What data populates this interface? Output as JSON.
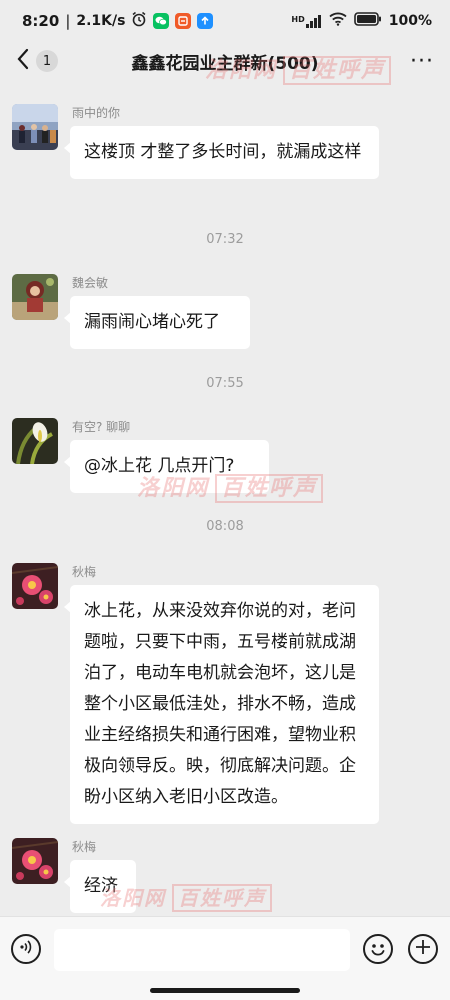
{
  "status_bar": {
    "time": "8:20",
    "network_speed": "2.1K/s",
    "signal_type": "HD",
    "battery": "100%",
    "icons": [
      "alarm-icon",
      "wechat-icon",
      "app-icon",
      "upload-icon",
      "signal-icon",
      "wifi-icon",
      "battery-icon"
    ]
  },
  "nav": {
    "unread_count": "1",
    "title": "鑫鑫花园业主群新(500)",
    "more_label": "···"
  },
  "messages": [
    {
      "sender": "雨中的你",
      "text": "这楼顶 才整了多长时间，就漏成这样"
    },
    {
      "time": "07:32"
    },
    {
      "sender": "魏会敏",
      "text": "漏雨闹心堵心死了"
    },
    {
      "time": "07:55"
    },
    {
      "sender": "有空? 聊聊",
      "text": "@冰上花  几点开门?"
    },
    {
      "time": "08:08"
    },
    {
      "sender": "秋梅",
      "text": "冰上花，从来没效弃你说的对，老问题啦，只要下中雨，五号楼前就成湖泊了，电动车电机就会泡坏，这儿是整个小区最低洼处，排水不畅，造成业主经络损失和通行困难，望物业积极向领导反。映，彻底解决问题。企盼小区纳入老旧小区改造。"
    },
    {
      "sender": "秋梅",
      "text": "经济"
    }
  ],
  "watermark": {
    "site": "洛阳网",
    "column": "百姓呼声"
  },
  "input_bar": {
    "placeholder": "",
    "icons": [
      "voice-icon",
      "emoji-icon",
      "plus-icon"
    ]
  },
  "colors": {
    "background": "#ededed",
    "bubble": "#ffffff",
    "watermark": "#e66e6e"
  }
}
